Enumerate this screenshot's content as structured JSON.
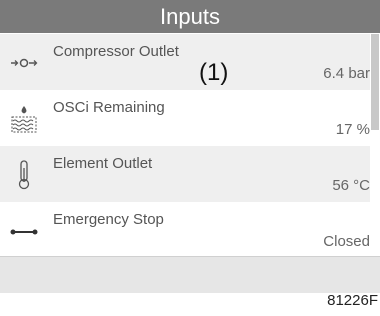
{
  "header": {
    "title": "Inputs"
  },
  "rows": [
    {
      "label": "Compressor Outlet",
      "value": "6.4 bar",
      "icon": "pressure-sensor-icon"
    },
    {
      "label": "OSCi Remaining",
      "value": "17 %",
      "icon": "water-tank-icon"
    },
    {
      "label": "Element Outlet",
      "value": "56 °C",
      "icon": "thermometer-icon"
    },
    {
      "label": "Emergency Stop",
      "value": "Closed",
      "icon": "switch-icon"
    }
  ],
  "callout": "(1)",
  "reference": "81226F"
}
